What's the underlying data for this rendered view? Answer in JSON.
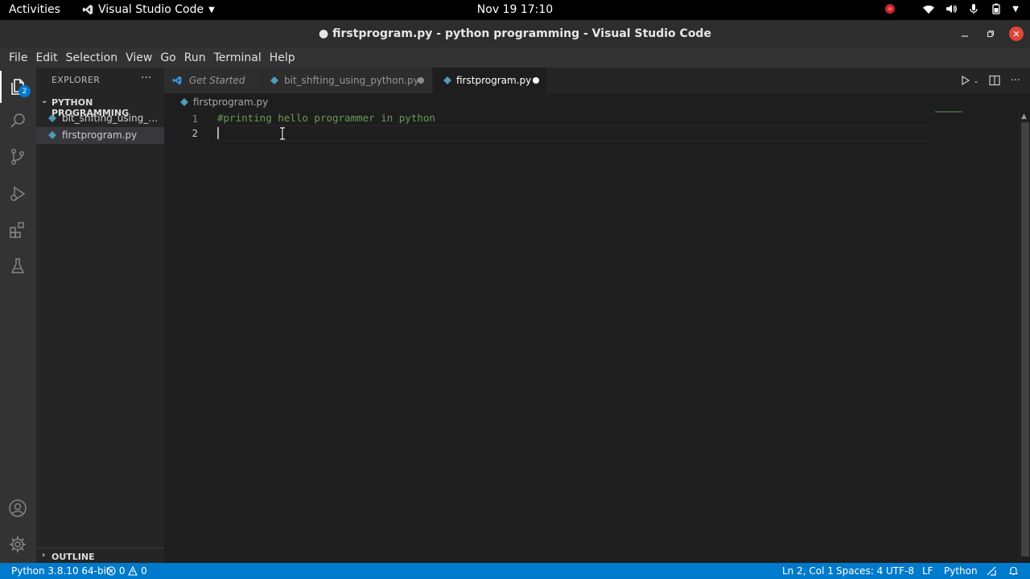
{
  "gnome_bar": {
    "activities": "Activities",
    "app_name": "Visual Studio Code",
    "clock": "Nov 19  17:10"
  },
  "window": {
    "title": "● firstprogram.py - python programming - Visual Studio Code"
  },
  "menu": [
    "File",
    "Edit",
    "Selection",
    "View",
    "Go",
    "Run",
    "Terminal",
    "Help"
  ],
  "activity_bar": {
    "explorer_badge": "2"
  },
  "sidebar": {
    "header": "EXPLORER",
    "more": "···",
    "folder": "PYTHON PROGRAMMING",
    "files": [
      {
        "name": "bit_shfting_using_python.py"
      },
      {
        "name": "firstprogram.py"
      }
    ],
    "outline": "OUTLINE"
  },
  "tabs": [
    {
      "label": "Get Started"
    },
    {
      "label": "bit_shfting_using_python.py"
    },
    {
      "label": "firstprogram.py"
    }
  ],
  "breadcrumb": "firstprogram.py",
  "editor": {
    "lines": [
      {
        "num": "1",
        "code": "#printing hello programmer in python"
      },
      {
        "num": "2",
        "code": ""
      }
    ]
  },
  "status": {
    "interpreter": "Python 3.8.10 64-bit",
    "errors": "0",
    "warnings": "0",
    "position": "Ln 2, Col 1",
    "spaces": "Spaces: 4",
    "encoding": "UTF-8",
    "eol": "LF",
    "language": "Python"
  },
  "colors": {
    "statusbar": "#007acc",
    "comment": "#6a9955",
    "python_icon": "#519aba",
    "close_button": "#e0453a"
  }
}
